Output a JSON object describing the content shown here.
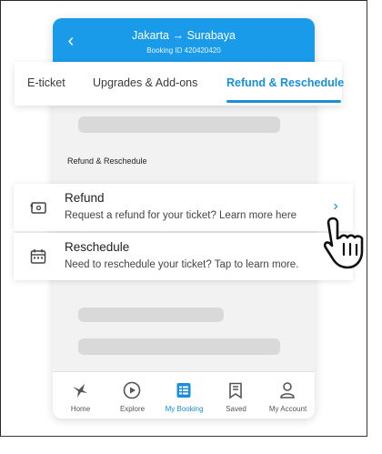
{
  "header": {
    "route": "Jakarta → Surabaya",
    "booking_id": "Booking ID 420420420",
    "back_icon": "back-arrow-icon"
  },
  "tabs": [
    {
      "label": "E-ticket",
      "active": false
    },
    {
      "label": "Upgrades & Add-ons",
      "active": false
    },
    {
      "label": "Refund & Reschedule",
      "active": true
    }
  ],
  "section": {
    "title": "Refund & Reschedule"
  },
  "cards": [
    {
      "title": "Refund",
      "subtitle": "Request a refund for your ticket? Learn more here",
      "icon": "ticket-refund-icon"
    },
    {
      "title": "Reschedule",
      "subtitle": "Need to reschedule your ticket? Tap to learn more.",
      "icon": "calendar-reschedule-icon"
    }
  ],
  "bottom_nav": [
    {
      "label": "Home",
      "icon": "bird-home-icon",
      "active": false
    },
    {
      "label": "Explore",
      "icon": "play-circle-icon",
      "active": false
    },
    {
      "label": "My Booking",
      "icon": "booking-list-icon",
      "active": true
    },
    {
      "label": "Saved",
      "icon": "bookmark-icon",
      "active": false
    },
    {
      "label": "My Account",
      "icon": "person-icon",
      "active": false
    }
  ],
  "colors": {
    "accent": "#1a8fd8",
    "header_bg": "#1a9bea",
    "skeleton": "#d9d9d9"
  }
}
